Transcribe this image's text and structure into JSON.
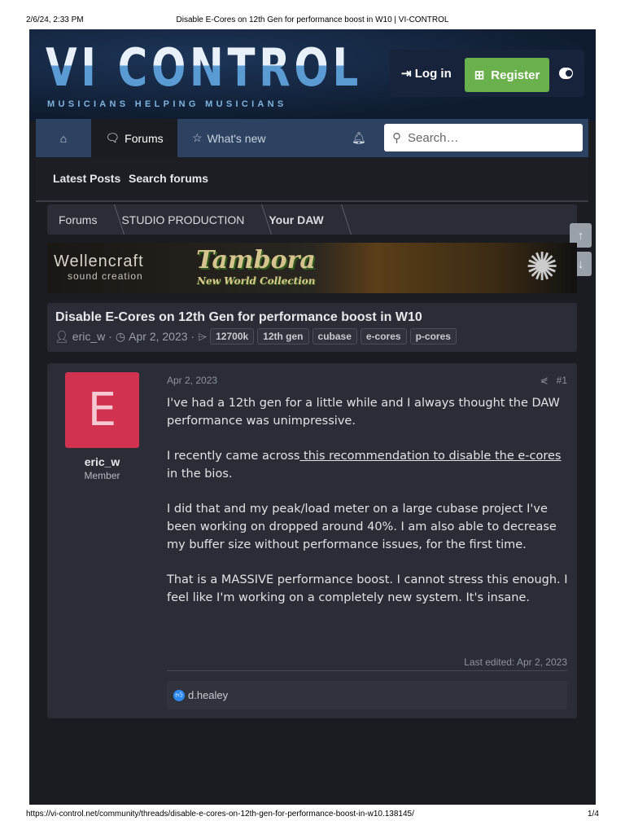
{
  "print_header": {
    "datetime": "2/6/24, 2:33 PM",
    "title": "Disable E-Cores on 12th Gen for performance boost in W10 | VI-CONTROL"
  },
  "print_footer": {
    "url": "https://vi-control.net/community/threads/disable-e-cores-on-12th-gen-for-performance-boost-in-w10.138145/",
    "page": "1/4"
  },
  "header": {
    "logo": "VI CONTROL",
    "tagline": "MUSICIANS HELPING MUSICIANS",
    "login": "Log in",
    "register": "Register"
  },
  "nav": {
    "forums": "Forums",
    "whats_new": "What's new",
    "search_placeholder": "Search…"
  },
  "subnav": {
    "latest": "Latest Posts",
    "search": "Search forums"
  },
  "breadcrumbs": [
    "Forums",
    "STUDIO PRODUCTION",
    "Your DAW"
  ],
  "banner": {
    "brand": "Wellencraft",
    "brand_sub": "sound creation",
    "product": "Tambora",
    "product_sub": "New World Collection"
  },
  "thread": {
    "title": "Disable E-Cores on 12th Gen for performance boost in W10",
    "author": "eric_w",
    "date": "Apr 2, 2023",
    "tags": [
      "12700k",
      "12th gen",
      "cubase",
      "e-cores",
      "p-cores"
    ]
  },
  "post": {
    "avatar_letter": "E",
    "username": "eric_w",
    "role": "Member",
    "date": "Apr 2, 2023",
    "number": "#1",
    "p1": "I've had a 12th gen for a little while and I always thought the DAW performance was unimpressive.",
    "p2_pre": "I recently came across",
    "p2_link": " this recommendation to disable the e-cores",
    "p2_post": " in the bios.",
    "p3": "I did that and my peak/load meter on a large cubase project I've been working on dropped around 40%. I am also able to decrease my buffer size without performance issues, for the first time.",
    "p4": "That is a MASSIVE performance boost. I cannot stress this enough. I feel like I'm working on a completely new system. It's insane.",
    "last_edited": "Last edited: Apr 2, 2023",
    "reaction_user": "d.healey"
  },
  "colors": {
    "accent": "#6ab04c",
    "avatar": "#d03250",
    "nav": "#2d4160"
  }
}
